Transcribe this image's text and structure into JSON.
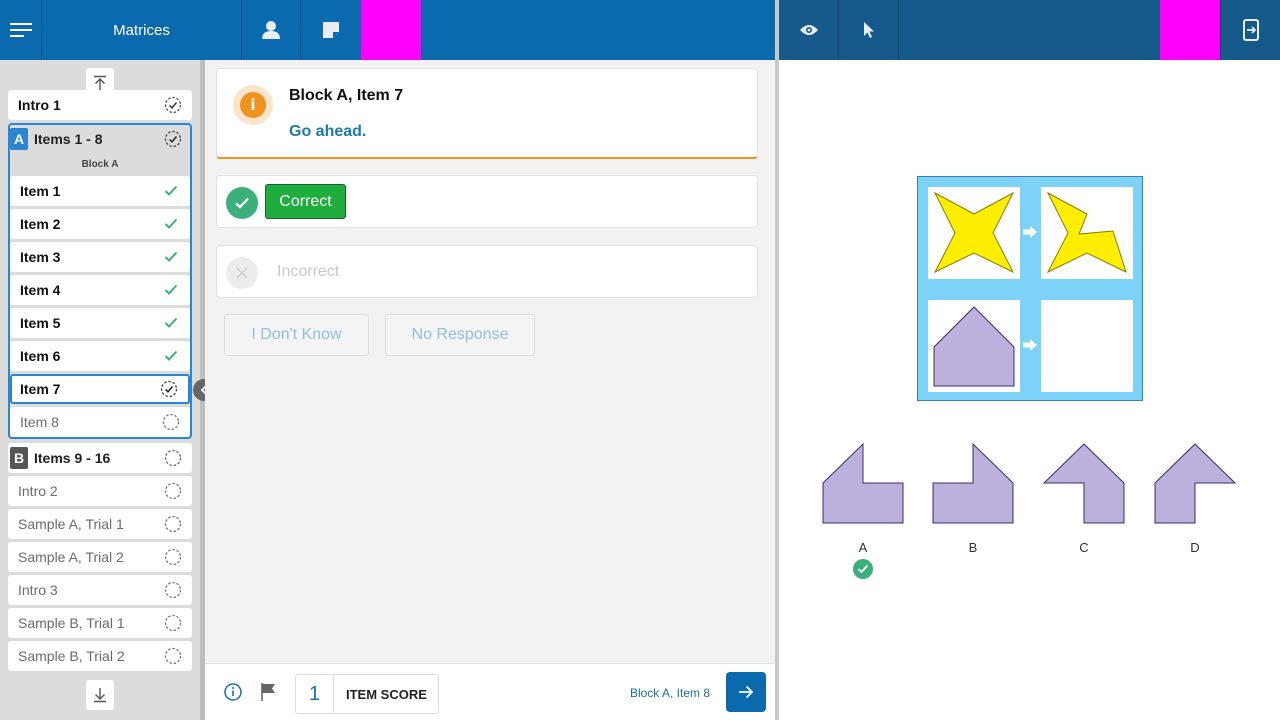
{
  "header": {
    "title": "Matrices",
    "accent_color": "#0a6aad",
    "right_color": "#155a8a",
    "magenta_color": "#ff00ff"
  },
  "sidebar": {
    "intro_partial": "Intro 1",
    "blockA": {
      "badge": "A",
      "title": "Items 1 - 8",
      "subtitle": "Block A"
    },
    "items": [
      {
        "label": "Item 1",
        "status": "done"
      },
      {
        "label": "Item 2",
        "status": "done"
      },
      {
        "label": "Item 3",
        "status": "done"
      },
      {
        "label": "Item 4",
        "status": "done"
      },
      {
        "label": "Item 5",
        "status": "done"
      },
      {
        "label": "Item 6",
        "status": "done"
      },
      {
        "label": "Item 7",
        "status": "current"
      },
      {
        "label": "Item 8",
        "status": "pending"
      }
    ],
    "blockB": {
      "badge": "B",
      "title": "Items 9 - 16"
    },
    "rest": [
      {
        "label": "Intro 2"
      },
      {
        "label": "Sample A, Trial 1"
      },
      {
        "label": "Sample A, Trial 2"
      },
      {
        "label": "Intro 3"
      },
      {
        "label": "Sample B, Trial 1"
      },
      {
        "label": "Sample B, Trial 2"
      }
    ]
  },
  "info": {
    "title": "Block A, Item 7",
    "message": "Go ahead.",
    "icon": "info-icon",
    "icon_glyph": "i"
  },
  "responses": {
    "correct_label": "Correct",
    "incorrect_label": "Incorrect",
    "dont_know_label": "I Don't Know",
    "no_response_label": "No Response"
  },
  "footer": {
    "score_value": "1",
    "score_label": "ITEM SCORE",
    "next_item": "Block A, Item 8"
  },
  "options": [
    "A",
    "B",
    "C",
    "D"
  ],
  "selected_option": "A"
}
